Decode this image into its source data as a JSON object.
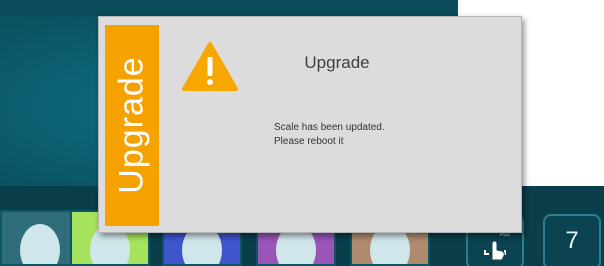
{
  "dialog": {
    "side_label": "Upgrade",
    "title": "Upgrade",
    "message_line1": "Scale has been updated.",
    "message_line2": "Please reboot it",
    "icon": "warning-icon"
  },
  "bottom_nav": {
    "page_number": "7",
    "print_icon": "print-icon"
  },
  "colors": {
    "accent_orange": "#f5a100",
    "dialog_bg": "#dcdcdc",
    "background_teal": "#0a5363"
  },
  "product_tiles": [
    {
      "color": "#2f6d7a"
    },
    {
      "color": "#a6e35c"
    },
    {
      "color": "#3f55cc"
    },
    {
      "color": "#9a55b6"
    },
    {
      "color": "#b08a6c"
    }
  ]
}
